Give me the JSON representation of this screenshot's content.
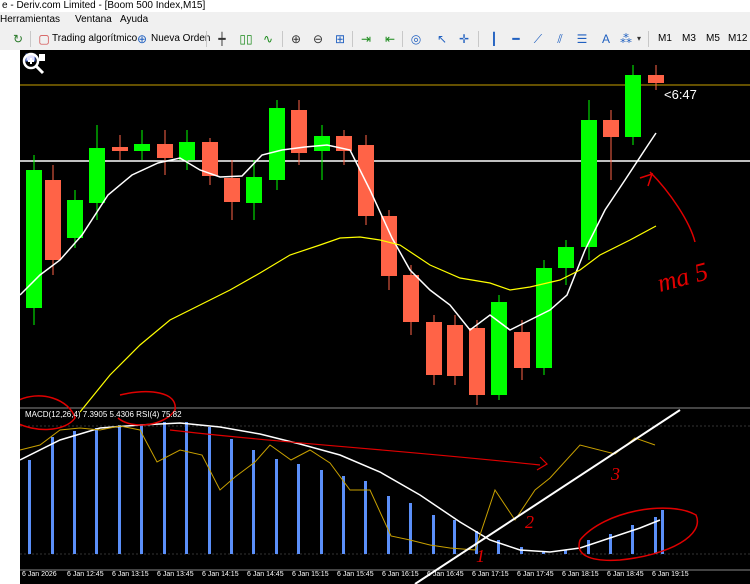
{
  "window": {
    "title": "e - Deriv.com Limited - [Boom 500 Index,M15]"
  },
  "menu": {
    "items": [
      "Herramientas",
      "Ventana",
      "Ayuda"
    ]
  },
  "toolbar": {
    "algo_label": "Trading algorítmico",
    "new_order_label": "Nueva Orden",
    "timeframes": [
      "M1",
      "M3",
      "M5",
      "M12"
    ]
  },
  "chart": {
    "countdown": "<6:47",
    "indicator_label": "MACD(12,26,4) 7.3905 5.4306 RSI(4) 75.82",
    "annotation": "ma 5",
    "annotation_numbers": [
      "1",
      "2",
      "3"
    ],
    "x_labels": [
      "6 Jan 2026",
      "6 Jan 12:45",
      "6 Jan 13:15",
      "6 Jan 13:45",
      "6 Jan 14:15",
      "6 Jan 14:45",
      "6 Jan 15:15",
      "6 Jan 15:45",
      "6 Jan 16:15",
      "6 Jan 16:45",
      "6 Jan 17:15",
      "6 Jan 17:45",
      "6 Jan 18:15",
      "6 Jan 18:45",
      "6 Jan 19:15"
    ],
    "colors": {
      "bull": "#00ff00",
      "bear": "#ff6347",
      "ma5": "#ffffff",
      "ma_slow": "#ffff00",
      "hist": "#5b8ff9",
      "annotation": "#e00000"
    }
  }
}
